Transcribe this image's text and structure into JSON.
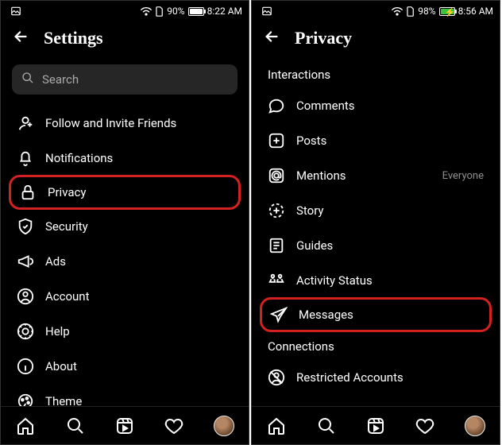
{
  "left": {
    "status": {
      "battery": "90%",
      "time": "8:22 AM",
      "charging": false,
      "batt_pct": 90
    },
    "header": {
      "title": "Settings"
    },
    "search": {
      "placeholder": "Search"
    },
    "menu": [
      {
        "icon": "follow-invite-icon",
        "label": "Follow and Invite Friends"
      },
      {
        "icon": "bell-icon",
        "label": "Notifications"
      },
      {
        "icon": "lock-icon",
        "label": "Privacy",
        "highlighted": true
      },
      {
        "icon": "shield-icon",
        "label": "Security"
      },
      {
        "icon": "megaphone-icon",
        "label": "Ads"
      },
      {
        "icon": "account-icon",
        "label": "Account"
      },
      {
        "icon": "help-icon",
        "label": "Help"
      },
      {
        "icon": "info-icon",
        "label": "About"
      },
      {
        "icon": "theme-icon",
        "label": "Theme"
      }
    ]
  },
  "right": {
    "status": {
      "battery": "98%",
      "time": "8:56 AM",
      "charging": true,
      "batt_pct": 98
    },
    "header": {
      "title": "Privacy"
    },
    "sections": {
      "interactions": {
        "title": "Interactions",
        "items": [
          {
            "icon": "comment-icon",
            "label": "Comments"
          },
          {
            "icon": "posts-icon",
            "label": "Posts"
          },
          {
            "icon": "mentions-icon",
            "label": "Mentions",
            "value": "Everyone"
          },
          {
            "icon": "story-icon",
            "label": "Story"
          },
          {
            "icon": "guides-icon",
            "label": "Guides"
          },
          {
            "icon": "activity-icon",
            "label": "Activity Status"
          },
          {
            "icon": "messages-icon",
            "label": "Messages",
            "highlighted": true
          }
        ]
      },
      "connections": {
        "title": "Connections",
        "items": [
          {
            "icon": "restricted-icon",
            "label": "Restricted Accounts"
          }
        ]
      }
    }
  },
  "highlight_color": "#d32121"
}
